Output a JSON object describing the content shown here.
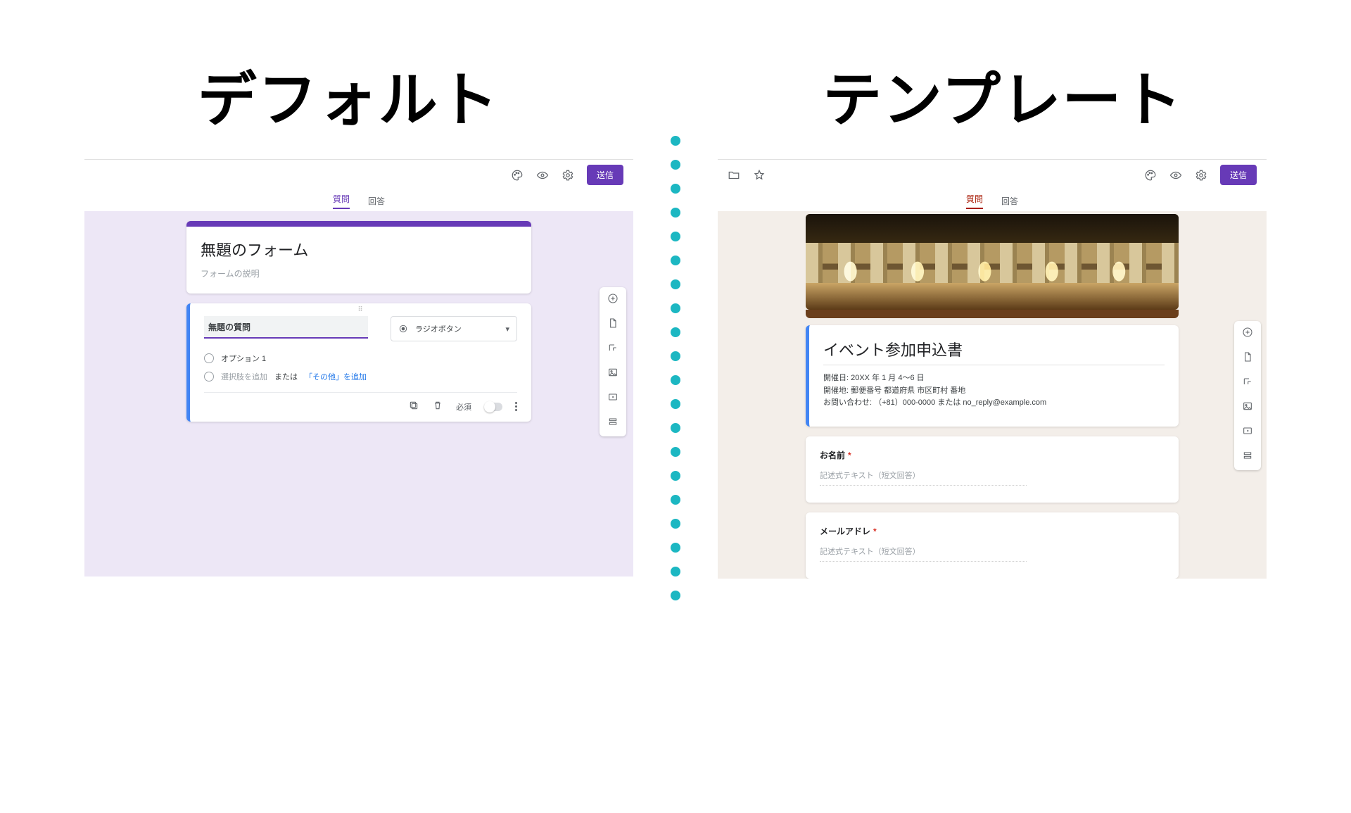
{
  "labels": {
    "left_heading": "デフォルト",
    "right_heading": "テンプレート"
  },
  "shared": {
    "tabs": {
      "questions": "質問",
      "responses": "回答"
    },
    "send": "送信"
  },
  "default_form": {
    "title": "無題のフォーム",
    "description_placeholder": "フォームの説明",
    "question": {
      "title_value": "無題の質問",
      "type_label": "ラジオボタン",
      "option1": "オプション 1",
      "add_option": "選択肢を追加",
      "or": "または",
      "add_other": "「その他」を追加",
      "required_label": "必須"
    }
  },
  "template_form": {
    "title": "イベント参加申込書",
    "description": "開催日: 20XX 年 1 月 4〜6 日\n開催地: 郵便番号 都道府県 市区町村 番地\nお問い合わせ: （+81）000-0000 または no_reply@example.com",
    "q1": {
      "label": "お名前",
      "placeholder": "記述式テキスト（短文回答）"
    },
    "q2": {
      "label": "メールアドレ",
      "placeholder": "記述式テキスト（短文回答）"
    }
  }
}
